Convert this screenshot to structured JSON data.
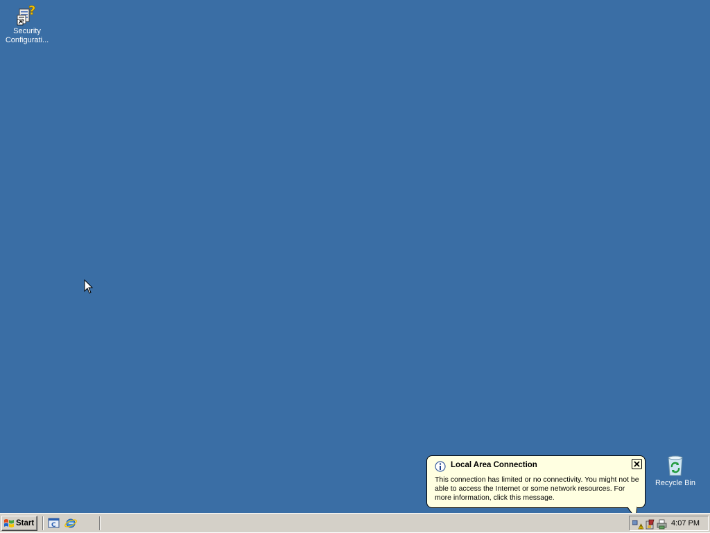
{
  "desktop": {
    "background_color": "#3a6ea5",
    "icons": [
      {
        "label": "Security Configurati...",
        "icon": "security-configuration-wizard-icon"
      },
      {
        "label": "Recycle Bin",
        "icon": "recycle-bin-icon"
      }
    ]
  },
  "balloon": {
    "title": "Local Area Connection",
    "message": "This connection has limited or no connectivity. You might not be able to access the Internet or some network resources. For more information, click this message.",
    "icon": "info-icon",
    "close_icon": "close-icon",
    "background_color": "#ffffe1"
  },
  "taskbar": {
    "start_label": "Start",
    "quick_launch": [
      {
        "icon": "show-desktop-icon"
      },
      {
        "icon": "internet-explorer-icon"
      }
    ],
    "tray": {
      "icons": [
        "network-warning-icon",
        "security-shield-icon",
        "printer-icon"
      ],
      "clock": "4:07 PM"
    },
    "background_color": "#d4d0c8"
  }
}
